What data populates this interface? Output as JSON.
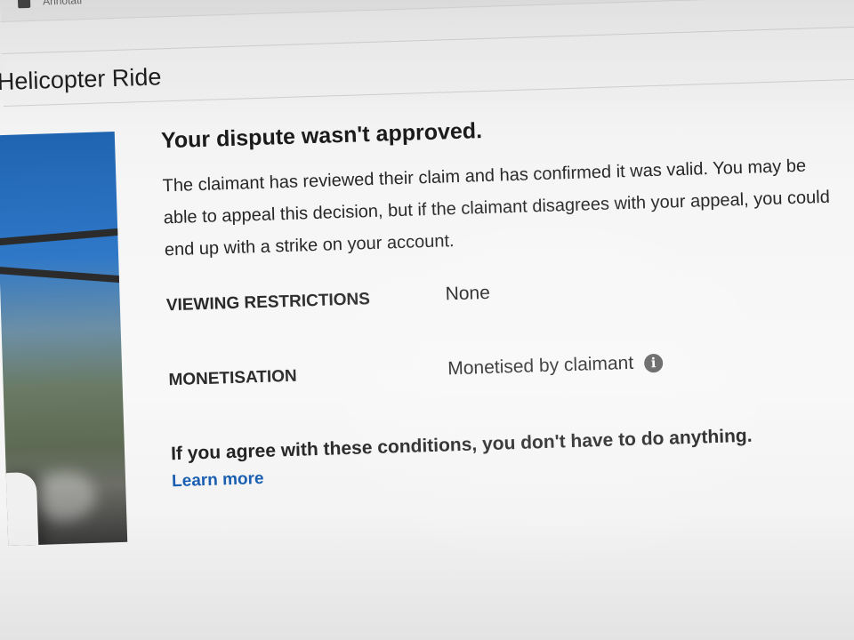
{
  "topbar": {
    "label": "Annotati",
    "icon": "comment-icon"
  },
  "video": {
    "title": "Helicopter Ride"
  },
  "dispute": {
    "headline": "Your dispute wasn't approved.",
    "body": "The claimant has reviewed their claim and has confirmed it was valid. You may be able to appeal this decision, but if the claimant disagrees with your appeal, you could end up with a strike on your account.",
    "rows": [
      {
        "label": "VIEWING RESTRICTIONS",
        "value": "None"
      },
      {
        "label": "MONETISATION",
        "value": "Monetised by claimant",
        "icon": "info-icon"
      }
    ],
    "agree_text": "If you agree with these conditions, you don't have to do anything.",
    "learn_more": "Learn more"
  },
  "colors": {
    "link": "#1a5fb2",
    "text": "#222222",
    "info_icon_bg": "#5d5d5d"
  }
}
